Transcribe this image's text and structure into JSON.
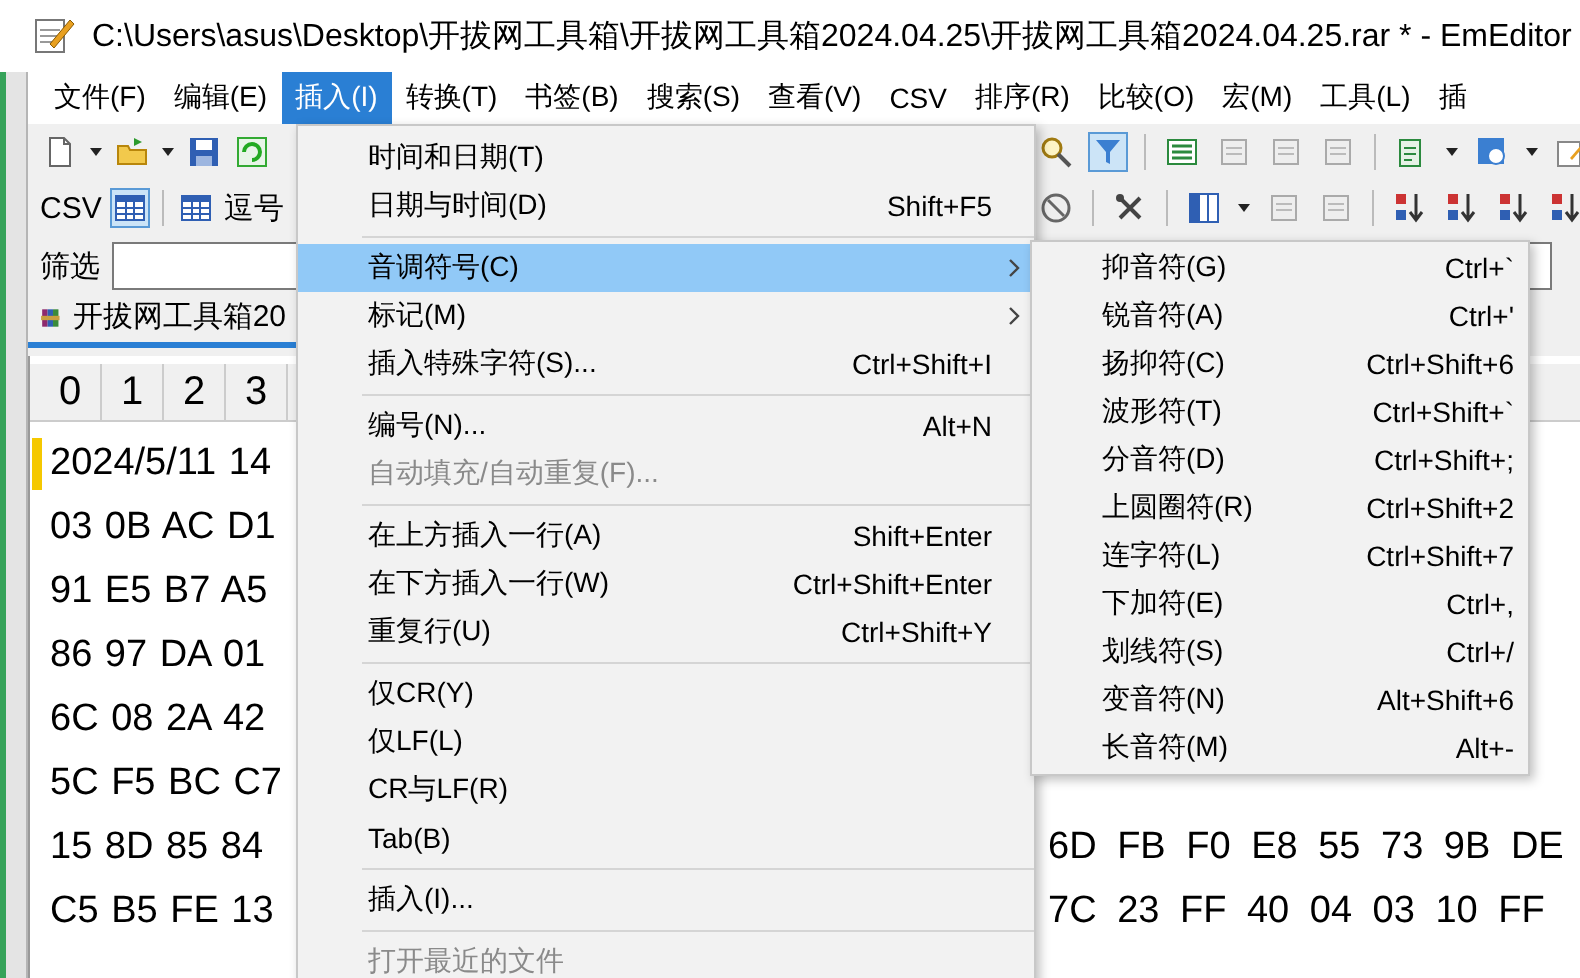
{
  "window": {
    "title": "C:\\Users\\asus\\Desktop\\开拔网工具箱\\开拔网工具箱2024.04.25\\开拔网工具箱2024.04.25.rar * - EmEditor"
  },
  "menu_bar": [
    {
      "label": "文件(F)",
      "selected": false
    },
    {
      "label": "编辑(E)",
      "selected": false
    },
    {
      "label": "插入(I)",
      "selected": true
    },
    {
      "label": "转换(T)",
      "selected": false
    },
    {
      "label": "书签(B)",
      "selected": false
    },
    {
      "label": "搜索(S)",
      "selected": false
    },
    {
      "label": "查看(V)",
      "selected": false
    },
    {
      "label": "CSV",
      "selected": false
    },
    {
      "label": "排序(R)",
      "selected": false
    },
    {
      "label": "比较(O)",
      "selected": false
    },
    {
      "label": "宏(M)",
      "selected": false
    },
    {
      "label": "工具(L)",
      "selected": false
    },
    {
      "label": "插",
      "selected": false
    }
  ],
  "toolbar": {
    "csv_label": "CSV",
    "csv_mode_pressed": true,
    "comma_label": "逗号",
    "filter_pressed": true
  },
  "filter_bar": {
    "label": "筛选"
  },
  "tab": {
    "label": "开拔网工具箱20"
  },
  "grid": {
    "columns": [
      "0",
      "1",
      "2",
      "3"
    ],
    "rows": [
      {
        "left": "2024/5/11 14",
        "marked": true
      },
      {
        "left": "03 0B AC D1",
        "marked": false
      },
      {
        "left": "91 E5 B7 A5",
        "marked": false
      },
      {
        "left": "86 97 DA 01",
        "marked": false
      },
      {
        "left": "6C 08 2A 42",
        "marked": false
      },
      {
        "left": "5C F5 BC C7",
        "marked": false
      },
      {
        "left": "15 8D 85 84",
        "right": "6D FB F0 E8 55 73 9B DE",
        "marked": false
      },
      {
        "left": "C5 B5 FE 13",
        "right": "7C 23 FF 40 04 03 10 FF",
        "marked": false
      }
    ]
  },
  "insert_menu": {
    "items": [
      {
        "kind": "item",
        "label": "时间和日期(T)",
        "selected": false,
        "disabled": false,
        "submenu": false
      },
      {
        "kind": "item",
        "label": "日期与时间(D)",
        "shortcut": "Shift+F5",
        "selected": false,
        "disabled": false,
        "submenu": false
      },
      {
        "kind": "separator"
      },
      {
        "kind": "item",
        "label": "音调符号(C)",
        "selected": true,
        "disabled": false,
        "submenu": true
      },
      {
        "kind": "item",
        "label": "标记(M)",
        "selected": false,
        "disabled": false,
        "submenu": true
      },
      {
        "kind": "item",
        "label": "插入特殊字符(S)...",
        "shortcut": "Ctrl+Shift+I",
        "selected": false,
        "disabled": false,
        "submenu": false
      },
      {
        "kind": "separator"
      },
      {
        "kind": "item",
        "label": "编号(N)...",
        "shortcut": "Alt+N",
        "selected": false,
        "disabled": false,
        "submenu": false
      },
      {
        "kind": "item",
        "label": "自动填充/自动重复(F)...",
        "selected": false,
        "disabled": true,
        "submenu": false
      },
      {
        "kind": "separator"
      },
      {
        "kind": "item",
        "label": "在上方插入一行(A)",
        "shortcut": "Shift+Enter",
        "selected": false,
        "disabled": false,
        "submenu": false
      },
      {
        "kind": "item",
        "label": "在下方插入一行(W)",
        "shortcut": "Ctrl+Shift+Enter",
        "selected": false,
        "disabled": false,
        "submenu": false
      },
      {
        "kind": "item",
        "label": "重复行(U)",
        "shortcut": "Ctrl+Shift+Y",
        "selected": false,
        "disabled": false,
        "submenu": false
      },
      {
        "kind": "separator"
      },
      {
        "kind": "item",
        "label": "仅CR(Y)",
        "selected": false,
        "disabled": false,
        "submenu": false
      },
      {
        "kind": "item",
        "label": "仅LF(L)",
        "selected": false,
        "disabled": false,
        "submenu": false
      },
      {
        "kind": "item",
        "label": "CR与LF(R)",
        "selected": false,
        "disabled": false,
        "submenu": false
      },
      {
        "kind": "item",
        "label": "Tab(B)",
        "selected": false,
        "disabled": false,
        "submenu": false
      },
      {
        "kind": "separator"
      },
      {
        "kind": "item",
        "label": "插入(I)...",
        "selected": false,
        "disabled": false,
        "submenu": false
      },
      {
        "kind": "separator"
      },
      {
        "kind": "item",
        "label": "打开最近的文件",
        "selected": false,
        "disabled": true,
        "submenu": false
      }
    ]
  },
  "accent_menu": {
    "items": [
      {
        "kind": "item",
        "label": "抑音符(G)",
        "shortcut": "Ctrl+`",
        "selected": false,
        "disabled": false,
        "submenu": false
      },
      {
        "kind": "item",
        "label": "锐音符(A)",
        "shortcut": "Ctrl+'",
        "selected": false,
        "disabled": false,
        "submenu": false
      },
      {
        "kind": "item",
        "label": "扬抑符(C)",
        "shortcut": "Ctrl+Shift+6",
        "selected": false,
        "disabled": false,
        "submenu": false
      },
      {
        "kind": "item",
        "label": "波形符(T)",
        "shortcut": "Ctrl+Shift+`",
        "selected": false,
        "disabled": false,
        "submenu": false
      },
      {
        "kind": "item",
        "label": "分音符(D)",
        "shortcut": "Ctrl+Shift+;",
        "selected": false,
        "disabled": false,
        "submenu": false
      },
      {
        "kind": "item",
        "label": "上圆圈符(R)",
        "shortcut": "Ctrl+Shift+2",
        "selected": false,
        "disabled": false,
        "submenu": false
      },
      {
        "kind": "item",
        "label": "连字符(L)",
        "shortcut": "Ctrl+Shift+7",
        "selected": false,
        "disabled": false,
        "submenu": false
      },
      {
        "kind": "item",
        "label": "下加符(E)",
        "shortcut": "Ctrl+,",
        "selected": false,
        "disabled": false,
        "submenu": false
      },
      {
        "kind": "item",
        "label": "划线符(S)",
        "shortcut": "Ctrl+/",
        "selected": false,
        "disabled": false,
        "submenu": false
      },
      {
        "kind": "item",
        "label": "变音符(N)",
        "shortcut": "Alt+Shift+6",
        "selected": false,
        "disabled": false,
        "submenu": false
      },
      {
        "kind": "item",
        "label": "长音符(M)",
        "shortcut": "Alt+-",
        "selected": false,
        "disabled": false,
        "submenu": false
      }
    ]
  }
}
